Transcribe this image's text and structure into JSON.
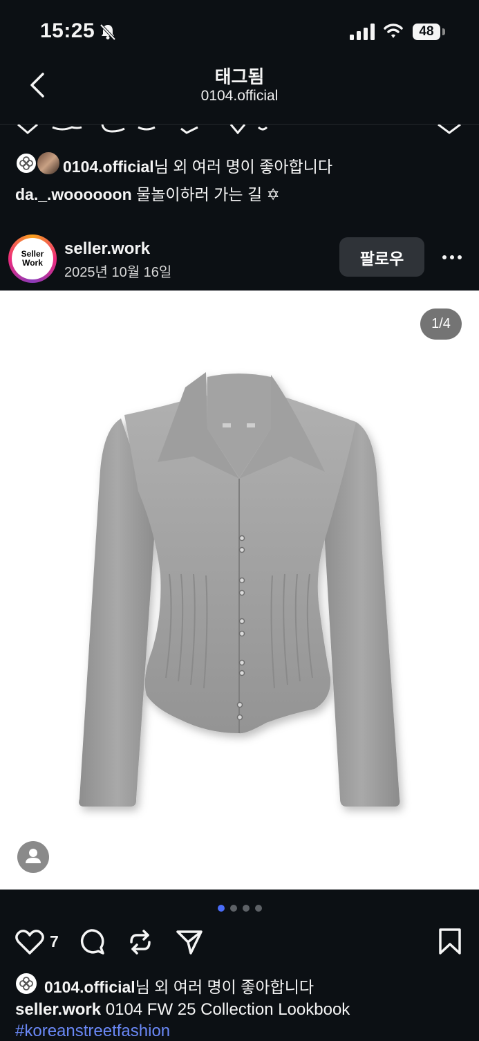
{
  "status_bar": {
    "time": "15:25",
    "battery": "48"
  },
  "header": {
    "title": "태그됨",
    "subtitle": "0104.official"
  },
  "previous_post": {
    "likes": {
      "user": "0104.official",
      "text": "님 외 여러 명이 좋아합니다"
    },
    "caption": {
      "user": "da._.woooooon",
      "text": " 물놀이하러 가는 길 ✡"
    }
  },
  "post": {
    "author": {
      "username": "seller.work",
      "avatar_line1": "Seller",
      "avatar_line2": "Work"
    },
    "date": "2025년 10월 16일",
    "follow_label": "팔로우",
    "image_counter": "1/4",
    "carousel": {
      "count": 4,
      "active": 1,
      "active_color": "#4a6cf7"
    },
    "like_count": "7",
    "likes": {
      "user": "0104.official",
      "text": "님 외 여러 명이 좋아합니다"
    },
    "caption": {
      "user": "seller.work",
      "text": " 0104 FW 25 Collection Lookbook"
    },
    "hashtag": "#koreanstreetfashion"
  }
}
